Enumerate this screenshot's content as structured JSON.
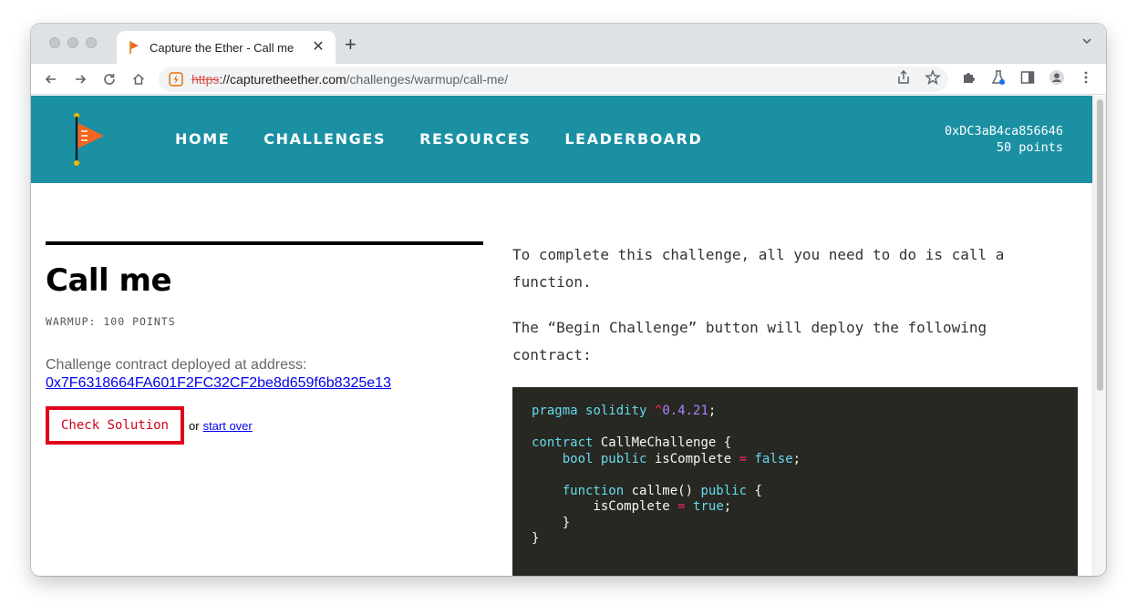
{
  "browser": {
    "tab_title": "Capture the Ether - Call me",
    "tab_close": "✕",
    "new_tab": "+",
    "url_scheme": "https",
    "url_host": "://capturetheether.com",
    "url_path": "/challenges/warmup/call-me/"
  },
  "site": {
    "nav": [
      {
        "label": "HOME"
      },
      {
        "label": "CHALLENGES"
      },
      {
        "label": "RESOURCES"
      },
      {
        "label": "LEADERBOARD"
      }
    ],
    "account_address": "0xDC3aB4ca856646",
    "account_points": "50 points",
    "brand_color": "#1b90a3"
  },
  "challenge": {
    "title": "Call me",
    "meta": "WARMUP: 100 POINTS",
    "deploy_label": "Challenge contract deployed at address:",
    "deploy_address": "0x7F6318664FA601F2FC32CF2be8d659f6b8325e13",
    "check_button": "Check Solution",
    "or_text": "or",
    "start_over": "start over"
  },
  "description": {
    "para1": "To complete this challenge, all you need to do is call a function.",
    "para2": "The “Begin Challenge” button will deploy the following contract:"
  }
}
